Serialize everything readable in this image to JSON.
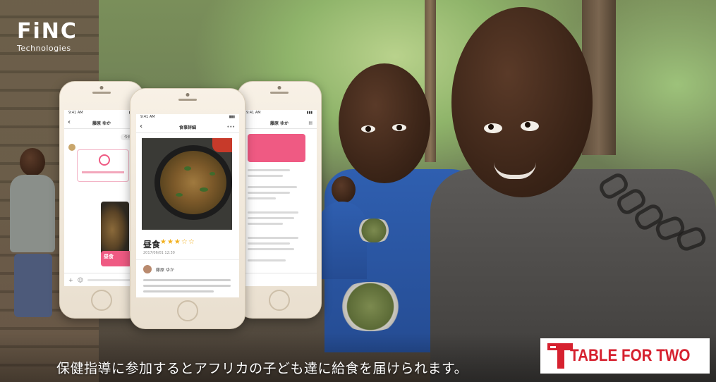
{
  "brand": {
    "logo_main": "FiNC",
    "logo_sub": "Technologies"
  },
  "phones": {
    "left": {
      "status_time": "9:41 AM",
      "nav_title": "藤原 ゆか",
      "chip": "今日",
      "meal_label": "昼食"
    },
    "center": {
      "status_time": "9:41 AM",
      "nav_title": "食事詳細",
      "meal_title": "昼食",
      "stars": "★★★☆☆",
      "date": "2017/06/01 12:30",
      "author": "藤原 ゆか"
    },
    "right": {
      "status_time": "9:41 AM",
      "nav_title": "藤原 ゆか"
    }
  },
  "caption": "保健指導に参加するとアフリカの子ども達に給食を届けられます。",
  "partner": {
    "name": "TABLE FOR TWO",
    "color": "#d6212f"
  },
  "accent_pink": "#ef5a83"
}
